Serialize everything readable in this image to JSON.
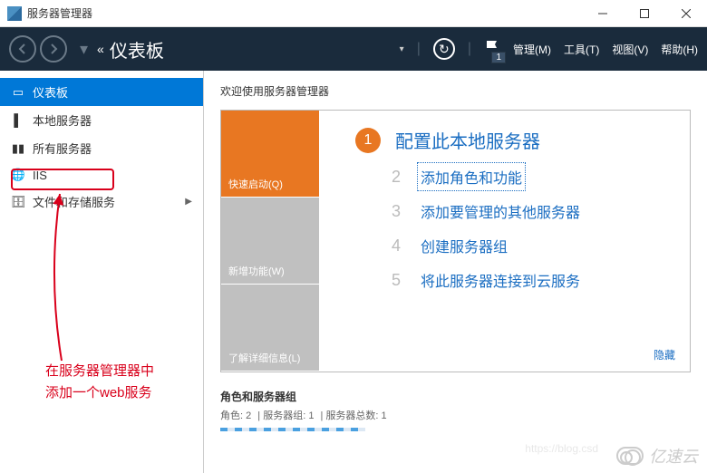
{
  "window": {
    "title": "服务器管理器"
  },
  "header": {
    "breadcrumb": "仪表板",
    "notif_count": "1",
    "menu": {
      "manage": "管理(M)",
      "tools": "工具(T)",
      "view": "视图(V)",
      "help": "帮助(H)"
    }
  },
  "sidebar": {
    "items": [
      {
        "label": "仪表板"
      },
      {
        "label": "本地服务器"
      },
      {
        "label": "所有服务器"
      },
      {
        "label": "IIS"
      },
      {
        "label": "文件和存储服务"
      }
    ]
  },
  "annotation": {
    "line1": "在服务器管理器中",
    "line2": "添加一个web服务"
  },
  "content": {
    "welcome": "欢迎使用服务器管理器",
    "tiles": {
      "quickstart": "快速启动(Q)",
      "whatsnew": "新增功能(W)",
      "learnmore": "了解详细信息(L)"
    },
    "steps": {
      "s1": "配置此本地服务器",
      "s2": "添加角色和功能",
      "s3": "添加要管理的其他服务器",
      "s4": "创建服务器组",
      "s5": "将此服务器连接到云服务"
    },
    "hide": "隐藏"
  },
  "footer": {
    "title": "角色和服务器组",
    "stats": {
      "roles": "角色: 2",
      "groups": "服务器组: 1",
      "total": "服务器总数: 1"
    }
  },
  "watermark": {
    "text": "亿速云",
    "blog": "https://blog.csd"
  }
}
